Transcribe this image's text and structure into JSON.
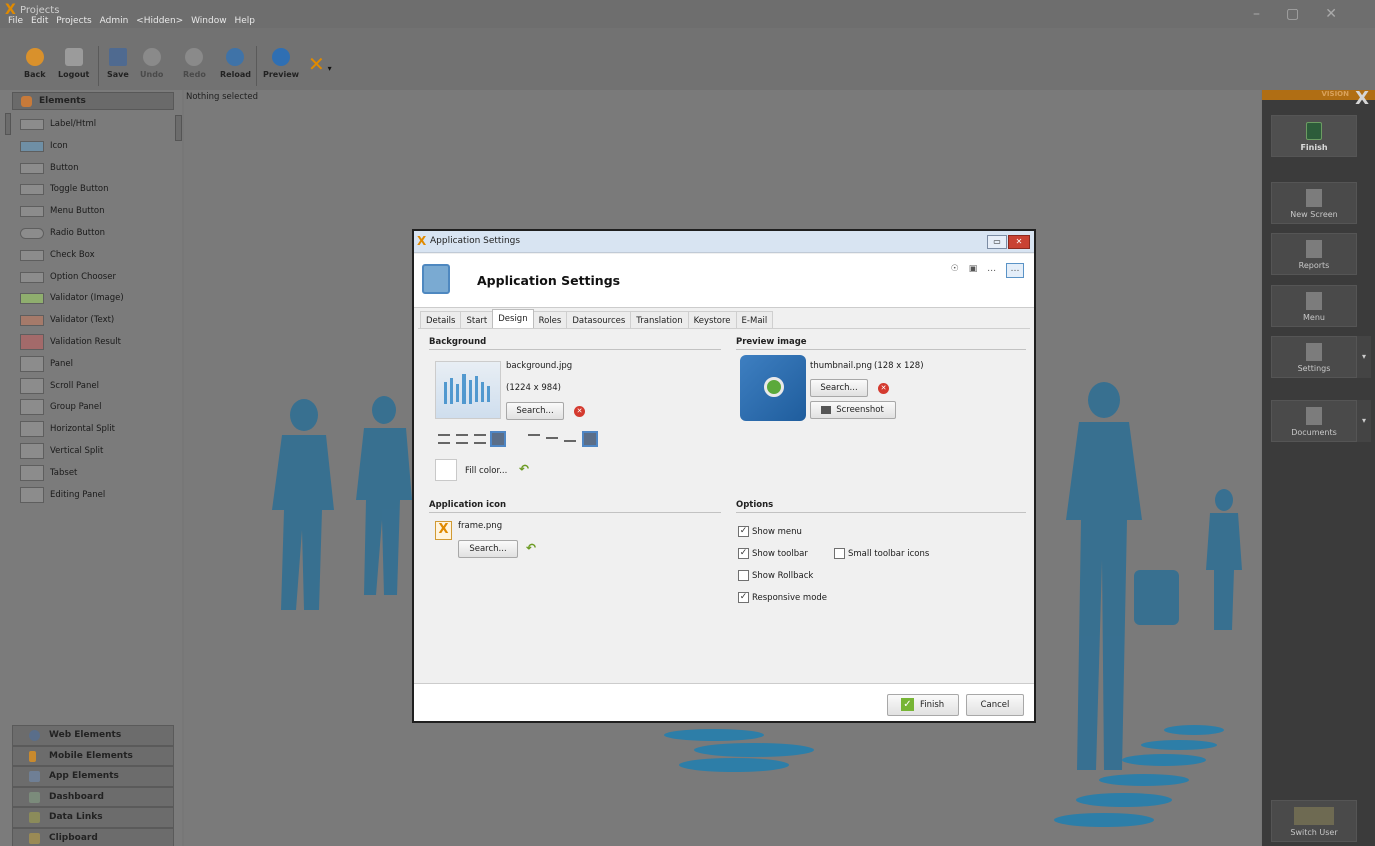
{
  "window": {
    "title": "Projects",
    "controls": [
      "–",
      "▢",
      "✕"
    ]
  },
  "menubar": [
    "File",
    "Edit",
    "Projects",
    "Admin",
    "<Hidden>",
    "Window",
    "Help"
  ],
  "toolbar": {
    "back": "Back",
    "logout": "Logout",
    "save": "Save",
    "undo": "Undo",
    "redo": "Redo",
    "reload": "Reload",
    "preview": "Preview"
  },
  "sidebar": {
    "header": "Elements",
    "items": [
      "Label/Html",
      "Icon",
      "Button",
      "Toggle Button",
      "Menu Button",
      "Radio Button",
      "Check Box",
      "Option Chooser",
      "Validator (Image)",
      "Validator (Text)",
      "Validation Result",
      "Panel",
      "Scroll Panel",
      "Group Panel",
      "Horizontal Split",
      "Vertical Split",
      "Tabset",
      "Editing Panel"
    ],
    "groups": [
      "Web Elements",
      "Mobile Elements",
      "App Elements",
      "Dashboard",
      "Data Links",
      "Clipboard"
    ]
  },
  "canvas": {
    "status": "Nothing selected"
  },
  "rightpanel": {
    "brand": "VISION",
    "buttons": [
      "Finish",
      "New Screen",
      "Reports",
      "Menu",
      "Settings",
      "Documents"
    ],
    "switch_user": "Switch User"
  },
  "dialog": {
    "window_title": "Application Settings",
    "heading": "Application Settings",
    "tabs": [
      "Details",
      "Start",
      "Design",
      "Roles",
      "Datasources",
      "Translation",
      "Keystore",
      "E-Mail"
    ],
    "active_tab": "Design",
    "background": {
      "title": "Background",
      "filename": "background.jpg",
      "dimensions": "(1224 x 984)",
      "search": "Search...",
      "fill_color": "Fill color..."
    },
    "preview_image": {
      "title": "Preview image",
      "filename": "thumbnail.png",
      "dimensions": "(128 x 128)",
      "search": "Search...",
      "screenshot": "Screenshot"
    },
    "application_icon": {
      "title": "Application icon",
      "filename": "frame.png",
      "search": "Search..."
    },
    "options": {
      "title": "Options",
      "show_menu": "Show menu",
      "show_toolbar": "Show toolbar",
      "small_toolbar_icons": "Small toolbar icons",
      "show_rollback": "Show Rollback",
      "responsive_mode": "Responsive mode"
    },
    "finish": "Finish",
    "cancel": "Cancel"
  },
  "colors": {
    "accent": "#e08a00",
    "background_gray": "#7a7a7a",
    "dialog_bg": "#f0f0f0",
    "silhouette_blue": "#2d6f95"
  }
}
